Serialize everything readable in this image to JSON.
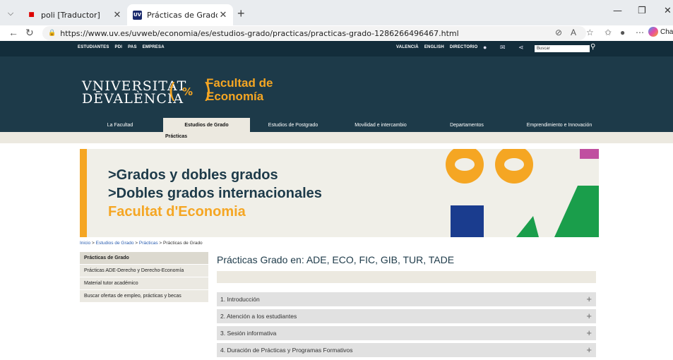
{
  "browser": {
    "tabs": [
      {
        "title": "poli [Traductor]",
        "active": false
      },
      {
        "title": "Prácticas de Grado",
        "active": true
      }
    ],
    "url": "https://www.uv.es/uvweb/economia/es/estudios-grado/practicas/practicas-grado-1286266496467.html",
    "chat_label": "Chat",
    "favicon_uv": "UV"
  },
  "topbar": {
    "left_links": [
      "ESTUDIANTES",
      "PDI",
      "PAS",
      "EMPRESA"
    ],
    "right_links": [
      "VALENCIÀ",
      "ENGLISH",
      "DIRECTORIO"
    ],
    "search_placeholder": "Buscar"
  },
  "header": {
    "uv_line1": "VNIVERSITAT",
    "uv_line2": "DĒVALÈNCIA",
    "faculty_line1": "Facultad de",
    "faculty_line2": "Economía",
    "logo_glyph": "%",
    "brand_color": "#f5a623"
  },
  "nav": {
    "items": [
      "La Facultad",
      "Estudios de Grado",
      "Estudios de Postgrado",
      "Movilidad e intercambio",
      "Departamentos",
      "Emprendimiento e Innovación"
    ],
    "active": "Estudios de Grado",
    "subnav_label": "Prácticas"
  },
  "banner": {
    "line1": ">Grados y dobles grados",
    "line2": ">Dobles grados internacionales",
    "line3": "Facultat d'Economia"
  },
  "breadcrumb": {
    "items": [
      "Inicio",
      "Estudios de Grado",
      "Prácticas"
    ],
    "current": "Prácticas de Grado",
    "separator": " > "
  },
  "sidebar": {
    "items": [
      {
        "label": "Prácticas de Grado",
        "active": true
      },
      {
        "label": "Prácticas ADE-Derecho y Derecho-Economía",
        "active": false
      },
      {
        "label": "Material tutor académico",
        "active": false
      },
      {
        "label": "Buscar ofertas de empleo, prácticas y becas",
        "active": false
      }
    ]
  },
  "content": {
    "title": "Prácticas Grado en: ADE, ECO, FIC, GIB, TUR, TADE",
    "sections": [
      "1. Introducción",
      "2. Atención a los estudiantes",
      "3. Sesión informativa",
      "4. Duración de Prácticas y Programas Formativos"
    ],
    "expand_glyph": "+"
  }
}
